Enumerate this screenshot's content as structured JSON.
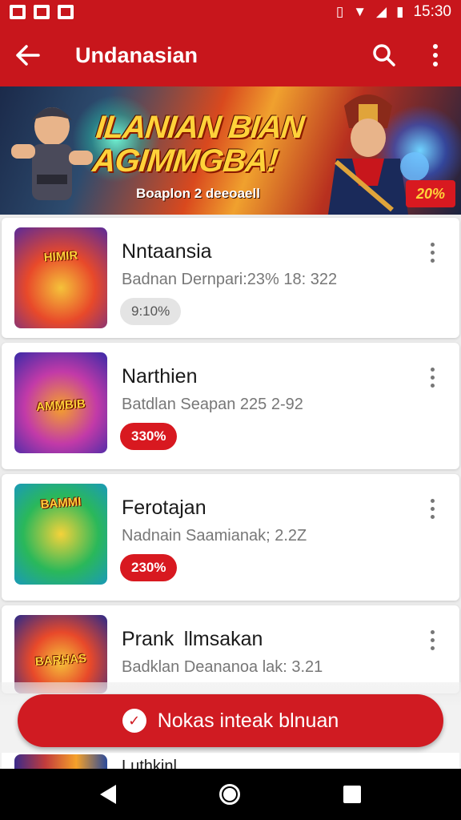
{
  "status_bar": {
    "time": "15:30",
    "icons": [
      "gallery-icon",
      "mail-icon",
      "image-icon",
      "vibrate-icon",
      "wifi-icon",
      "signal-icon",
      "battery-icon"
    ]
  },
  "app_bar": {
    "title": "Undanasian",
    "back_icon": "arrow-left-icon",
    "search_icon": "search-icon",
    "menu_icon": "more-vert-icon"
  },
  "banner": {
    "title_line1": "ILANIAN BIAN",
    "title_line2": "AGIMMGBA!",
    "subtitle": "Boaplon 2 deeoaell",
    "badge": "20%"
  },
  "games": [
    {
      "title": "Nntaansia",
      "subtitle": "Badnan Dernpari:23% 18: 322",
      "tag": "9:10%",
      "tag_style": "grey",
      "thumb_label": "HIMIR",
      "colors": [
        "#5a2a9a",
        "#e8492a",
        "#f5c23a"
      ]
    },
    {
      "title": "Narthien",
      "subtitle": "Batdlan Seapan 225 2-92",
      "tag": "330%",
      "tag_style": "red",
      "thumb_label": "AMMBIB",
      "colors": [
        "#3a2aa8",
        "#c23aa8",
        "#f5a12a"
      ]
    },
    {
      "title": "Ferotajan",
      "subtitle": "Nadnain Saamianak; 2.2Z",
      "tag": "230%",
      "tag_style": "red",
      "thumb_label": "BAMMI",
      "colors": [
        "#1a9ab8",
        "#2ab85a",
        "#f5d23a"
      ]
    },
    {
      "title": "Prank llmsakan",
      "subtitle": "Badklan Deananoa lak: 3.21",
      "tag": "",
      "tag_style": "red",
      "thumb_label": "BARHAS",
      "colors": [
        "#2a2a8a",
        "#e8492a",
        "#f5c23a"
      ]
    }
  ],
  "fab": {
    "label": "Nokas inteak blnuan",
    "icon": "chat-check-icon"
  },
  "peek_title": "Luthkinl",
  "nav": {
    "back_icon": "nav-back-icon",
    "home_icon": "nav-home-icon",
    "recent_icon": "nav-recent-icon"
  }
}
